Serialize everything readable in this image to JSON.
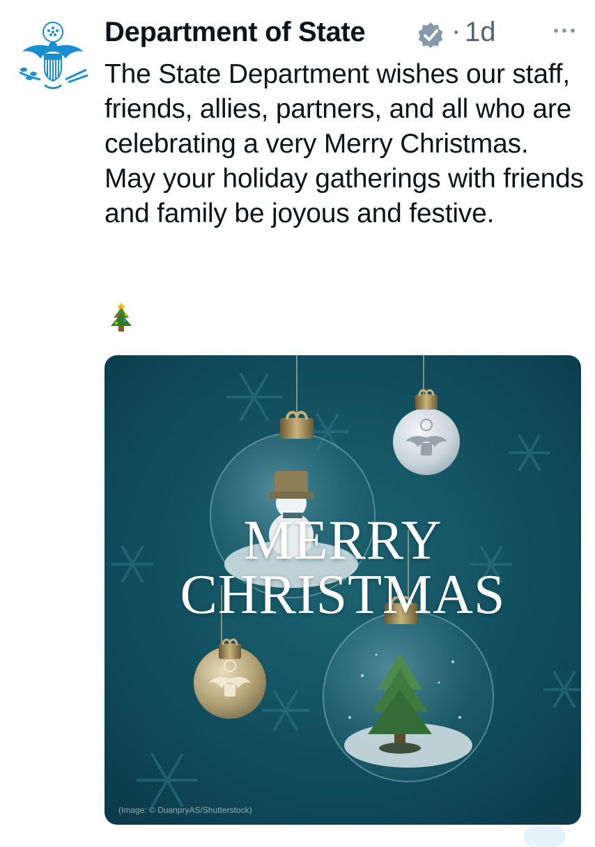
{
  "tweet": {
    "author_name": "Department of State",
    "separator": "·",
    "time": "1d",
    "text": "The State Department wishes our staff, friends, allies, partners, and all who are celebrating a very Merry Christmas. May your holiday gatherings with friends and family be joyous and festive.",
    "emoji_icon": "christmas-tree-icon",
    "verified_icon": "verified-badge-icon",
    "more_icon": "more-options-icon"
  },
  "media": {
    "title_line1": "MERRY",
    "title_line2": "CHRISTMAS",
    "credit": "(Image: © DuanpryAS/Shutterstock)"
  },
  "colors": {
    "background": "#ffffff",
    "text": "#0f1419",
    "muted": "#536471",
    "verified": "#829aab",
    "brand": "#1d9bf0",
    "card_bg": "#0f4a5a"
  }
}
